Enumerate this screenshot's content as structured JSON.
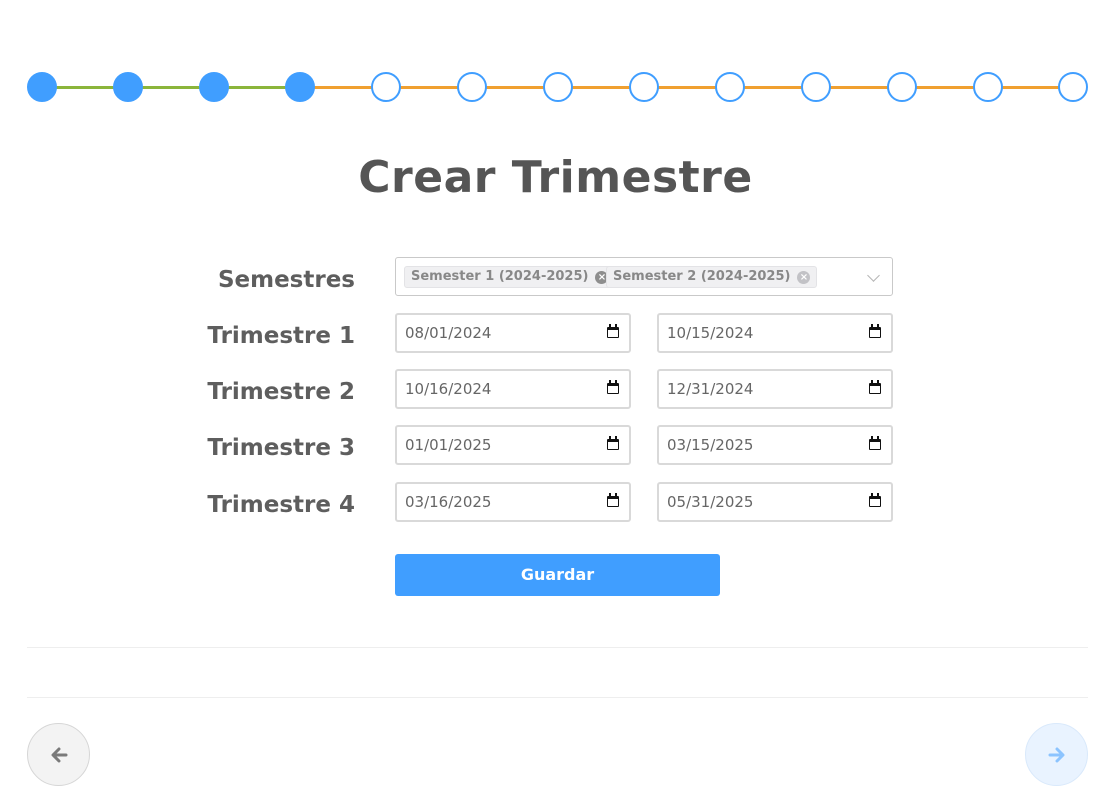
{
  "stepper": {
    "total_steps": 13,
    "completed_steps": 4,
    "colors": {
      "active": "#409eff",
      "done_line": "#8bb53b",
      "todo_line": "#f0a030"
    }
  },
  "page": {
    "title": "Crear Trimestre"
  },
  "form": {
    "semestres": {
      "label": "Semestres",
      "tags": [
        {
          "label": "Semester 1 (2024-2025)",
          "remove_icon": "close-circle-icon"
        },
        {
          "label": "Semester 2 (2024-2025)",
          "remove_icon": "close-circle-icon"
        }
      ],
      "dropdown_icon": "chevron-down-icon"
    },
    "trimestres": [
      {
        "label": "Trimestre 1",
        "start": "08/01/2024",
        "end": "10/15/2024"
      },
      {
        "label": "Trimestre 2",
        "start": "10/16/2024",
        "end": "12/31/2024"
      },
      {
        "label": "Trimestre 3",
        "start": "01/01/2025",
        "end": "03/15/2025"
      },
      {
        "label": "Trimestre 4",
        "start": "03/16/2025",
        "end": "05/31/2025"
      }
    ],
    "save_label": "Guardar"
  },
  "navigation": {
    "prev_icon": "arrow-left-icon",
    "next_icon": "arrow-right-icon"
  },
  "colors": {
    "primary": "#409eff",
    "title": "#555555"
  }
}
